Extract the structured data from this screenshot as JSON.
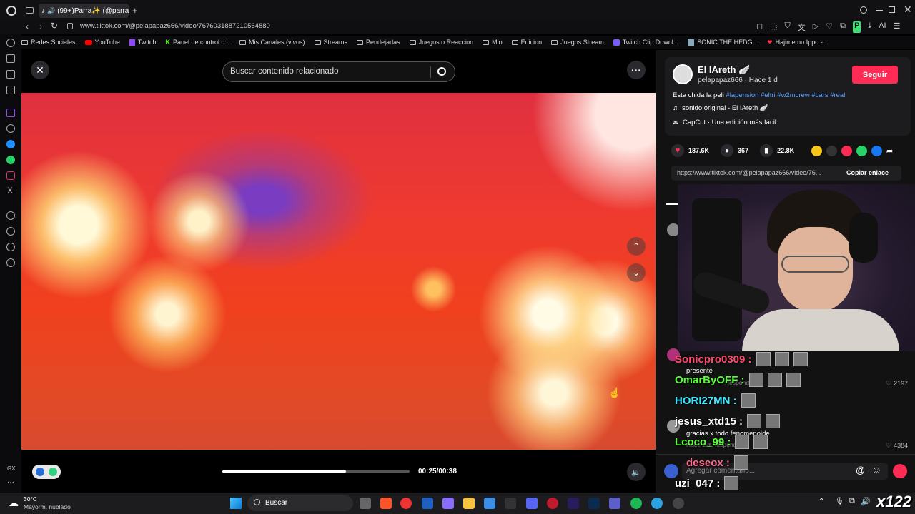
{
  "browser": {
    "tab_title": "(99+)Parra✨ (@parra",
    "url": "www.tiktok.com/@pelapapaz666/video/7676031887210564880",
    "bookmarks": [
      "Redes Sociales",
      "YouTube",
      "Twitch",
      "Panel de control d...",
      "Mis Canales (vivos)",
      "Streams",
      "Pendejadas",
      "Juegos o Reaccion",
      "Mio",
      "Edicion",
      "Juegos Stream",
      "Twitch Clip Downl...",
      "SONIC THE HEDG...",
      "Hajime no Ippo -..."
    ],
    "sidebar_label": "GX"
  },
  "viewer": {
    "search_placeholder": "Buscar contenido relacionado",
    "time": "00:25/00:38",
    "progress": 0.66
  },
  "post": {
    "author": "El IAreth 🪽",
    "handle": "pelapapaz666",
    "age": "Hace 1 d",
    "follow_label": "Seguir",
    "caption": "Esta chida la peli",
    "hashtags": "#lapension #eltri #w2mcrew #cars #real",
    "sound": "sonido original - El IAreth 🪽",
    "capcut": "CapCut · Una edición más fácil",
    "likes": "187.6K",
    "comments": "367",
    "saves": "22.8K",
    "link": "https://www.tiktok.com/@pelapapaz666/video/76...",
    "copy_label": "Copiar enlace"
  },
  "comments": {
    "items": [
      {
        "text": "presente",
        "meta": "Responder",
        "likes": "2197"
      },
      {
        "text": "gracias x todo fenomenoide",
        "meta": "Hace 1 d  Responder",
        "likes": "4384"
      }
    ],
    "input_placeholder": "Agregar comentario..."
  },
  "chat": [
    {
      "user": "Sonicpro0309 :",
      "color": "#ff4b6e"
    },
    {
      "user": "OmarByOFF :",
      "color": "#59ff3b"
    },
    {
      "user": "HORI27MN :",
      "color": "#3be8ff"
    },
    {
      "user": "jesus_xtd15 :",
      "color": "#ffffff"
    },
    {
      "user": "Lcoco_99 :",
      "color": "#59ff3b"
    },
    {
      "user": "deseox :",
      "color": "#ff6b8e"
    },
    {
      "user": "uzi_047 :",
      "color": "#ffffff"
    }
  ],
  "taskbar": {
    "temp": "30°C",
    "weather": "Mayorm. nublado",
    "search": "Buscar",
    "watermark": "x122"
  }
}
